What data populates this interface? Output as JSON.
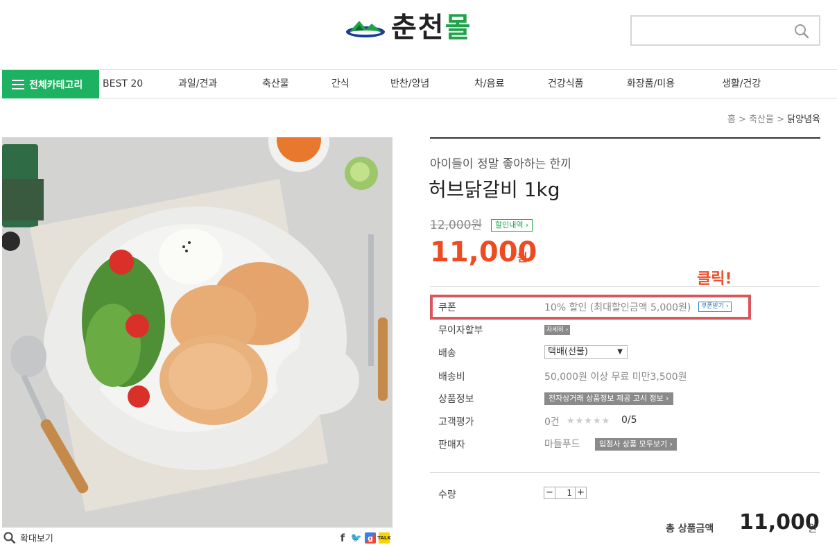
{
  "header": {
    "logo_text_a": "춘천",
    "logo_text_b": "몰",
    "search_placeholder": ""
  },
  "nav": {
    "all_categories": "전체카테고리",
    "items": [
      "BEST 20",
      "과일/견과",
      "축산물",
      "간식",
      "반찬/양념",
      "차/음료",
      "건강식품",
      "화장품/미용",
      "생활/건강"
    ]
  },
  "breadcrumb": {
    "home": "홈",
    "sep": ">",
    "category": "축산물",
    "current": "닭양념육"
  },
  "image": {
    "zoom_label": "확대보기"
  },
  "product": {
    "subtitle": "아이들이 정말 좋아하는 한끼",
    "title": "허브닭갈비 1kg",
    "original_price": "12,000원",
    "discount_badge": "할인내역 ›",
    "sale_price": "11,000",
    "currency": "원",
    "click_note": "클릭!"
  },
  "details": {
    "coupon": {
      "label": "쿠폰",
      "value": "10% 할인 (최대할인금액 5,000원)",
      "button": "쿠폰받기 ›"
    },
    "installment": {
      "label": "무이자할부",
      "button": "자세히 ›"
    },
    "shipping": {
      "label": "배송",
      "selected": "택배(선불)"
    },
    "shipping_fee": {
      "label": "배송비",
      "value": "50,000원 이상 무료 미만3,500원"
    },
    "product_info": {
      "label": "상품정보",
      "button": "전자상거래 상품정보 제공 고시 정보 ›"
    },
    "review": {
      "label": "고객평가",
      "count": "0건",
      "stars": "★★★★★",
      "score": "0/5"
    },
    "seller": {
      "label": "판매자",
      "value": "마들푸드",
      "button": "입점사 상품 모두보기 ›"
    }
  },
  "quantity": {
    "label": "수량",
    "minus": "−",
    "value": "1",
    "plus": "+"
  },
  "total": {
    "label": "총 상품금액",
    "price": "11,000",
    "currency": "원"
  },
  "colors": {
    "brand_green": "#1db162",
    "sale_red": "#ef4b23",
    "highlight": "#d9575c"
  }
}
